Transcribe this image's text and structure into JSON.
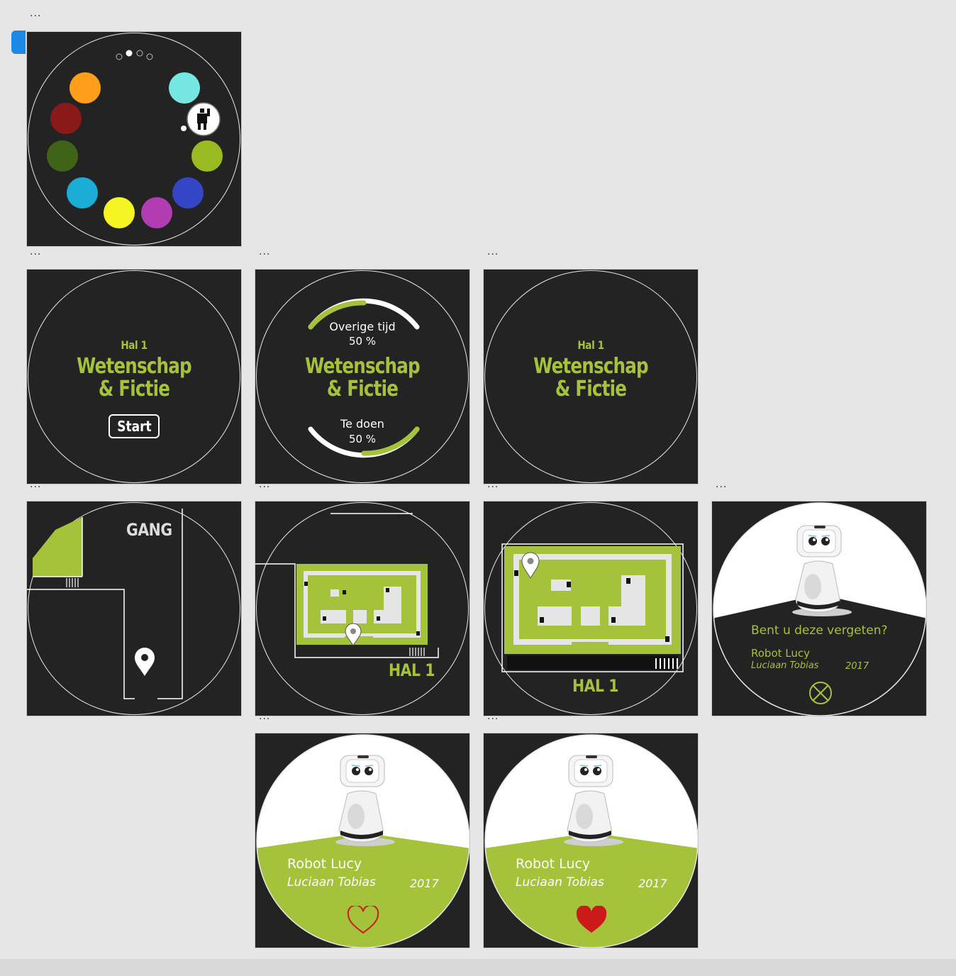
{
  "colors": {
    "frame_bg": "#232323",
    "accent_green": "#a4c23a",
    "heart_red": "#cc1a1a",
    "palette": [
      "#ff9e1b",
      "#75e6e1",
      "#8a1a1a",
      "#9aba22",
      "#3f6417",
      "#3446c5",
      "#1aadd6",
      "#f5f524",
      "#b23cb2"
    ]
  },
  "icons": [
    "robot-person-icon",
    "map-pin-icon",
    "heart-outline-icon",
    "heart-filled-icon",
    "close-circle-icon",
    "page-dots-icon"
  ],
  "frame_menu_label": "...",
  "screens": {
    "hall_start": {
      "hal": "Hal 1",
      "title_line1": "Wetenschap",
      "title_line2": "& Fictie",
      "start_label": "Start"
    },
    "progress": {
      "remaining_label": "Overige tijd",
      "remaining_value": "50 %",
      "title_line1": "Wetenschap",
      "title_line2": "& Fictie",
      "todo_label": "Te doen",
      "todo_value": "50 %",
      "remaining_fraction": 0.5,
      "todo_fraction": 0.5
    },
    "hall_title": {
      "hal": "Hal 1",
      "title_line1": "Wetenschap",
      "title_line2": "& Fictie"
    },
    "map_gang": {
      "title": "GANG"
    },
    "map_hal_small": {
      "title": "HAL 1"
    },
    "map_hal_large": {
      "title": "HAL 1"
    },
    "forgot": {
      "question": "Bent u deze vergeten?",
      "item_name": "Robot Lucy",
      "author": "Luciaan Tobias",
      "year": "2017"
    },
    "artwork_unliked": {
      "item_name": "Robot Lucy",
      "author": "Luciaan Tobias",
      "year": "2017"
    },
    "artwork_liked": {
      "item_name": "Robot Lucy",
      "author": "Luciaan Tobias",
      "year": "2017"
    }
  }
}
